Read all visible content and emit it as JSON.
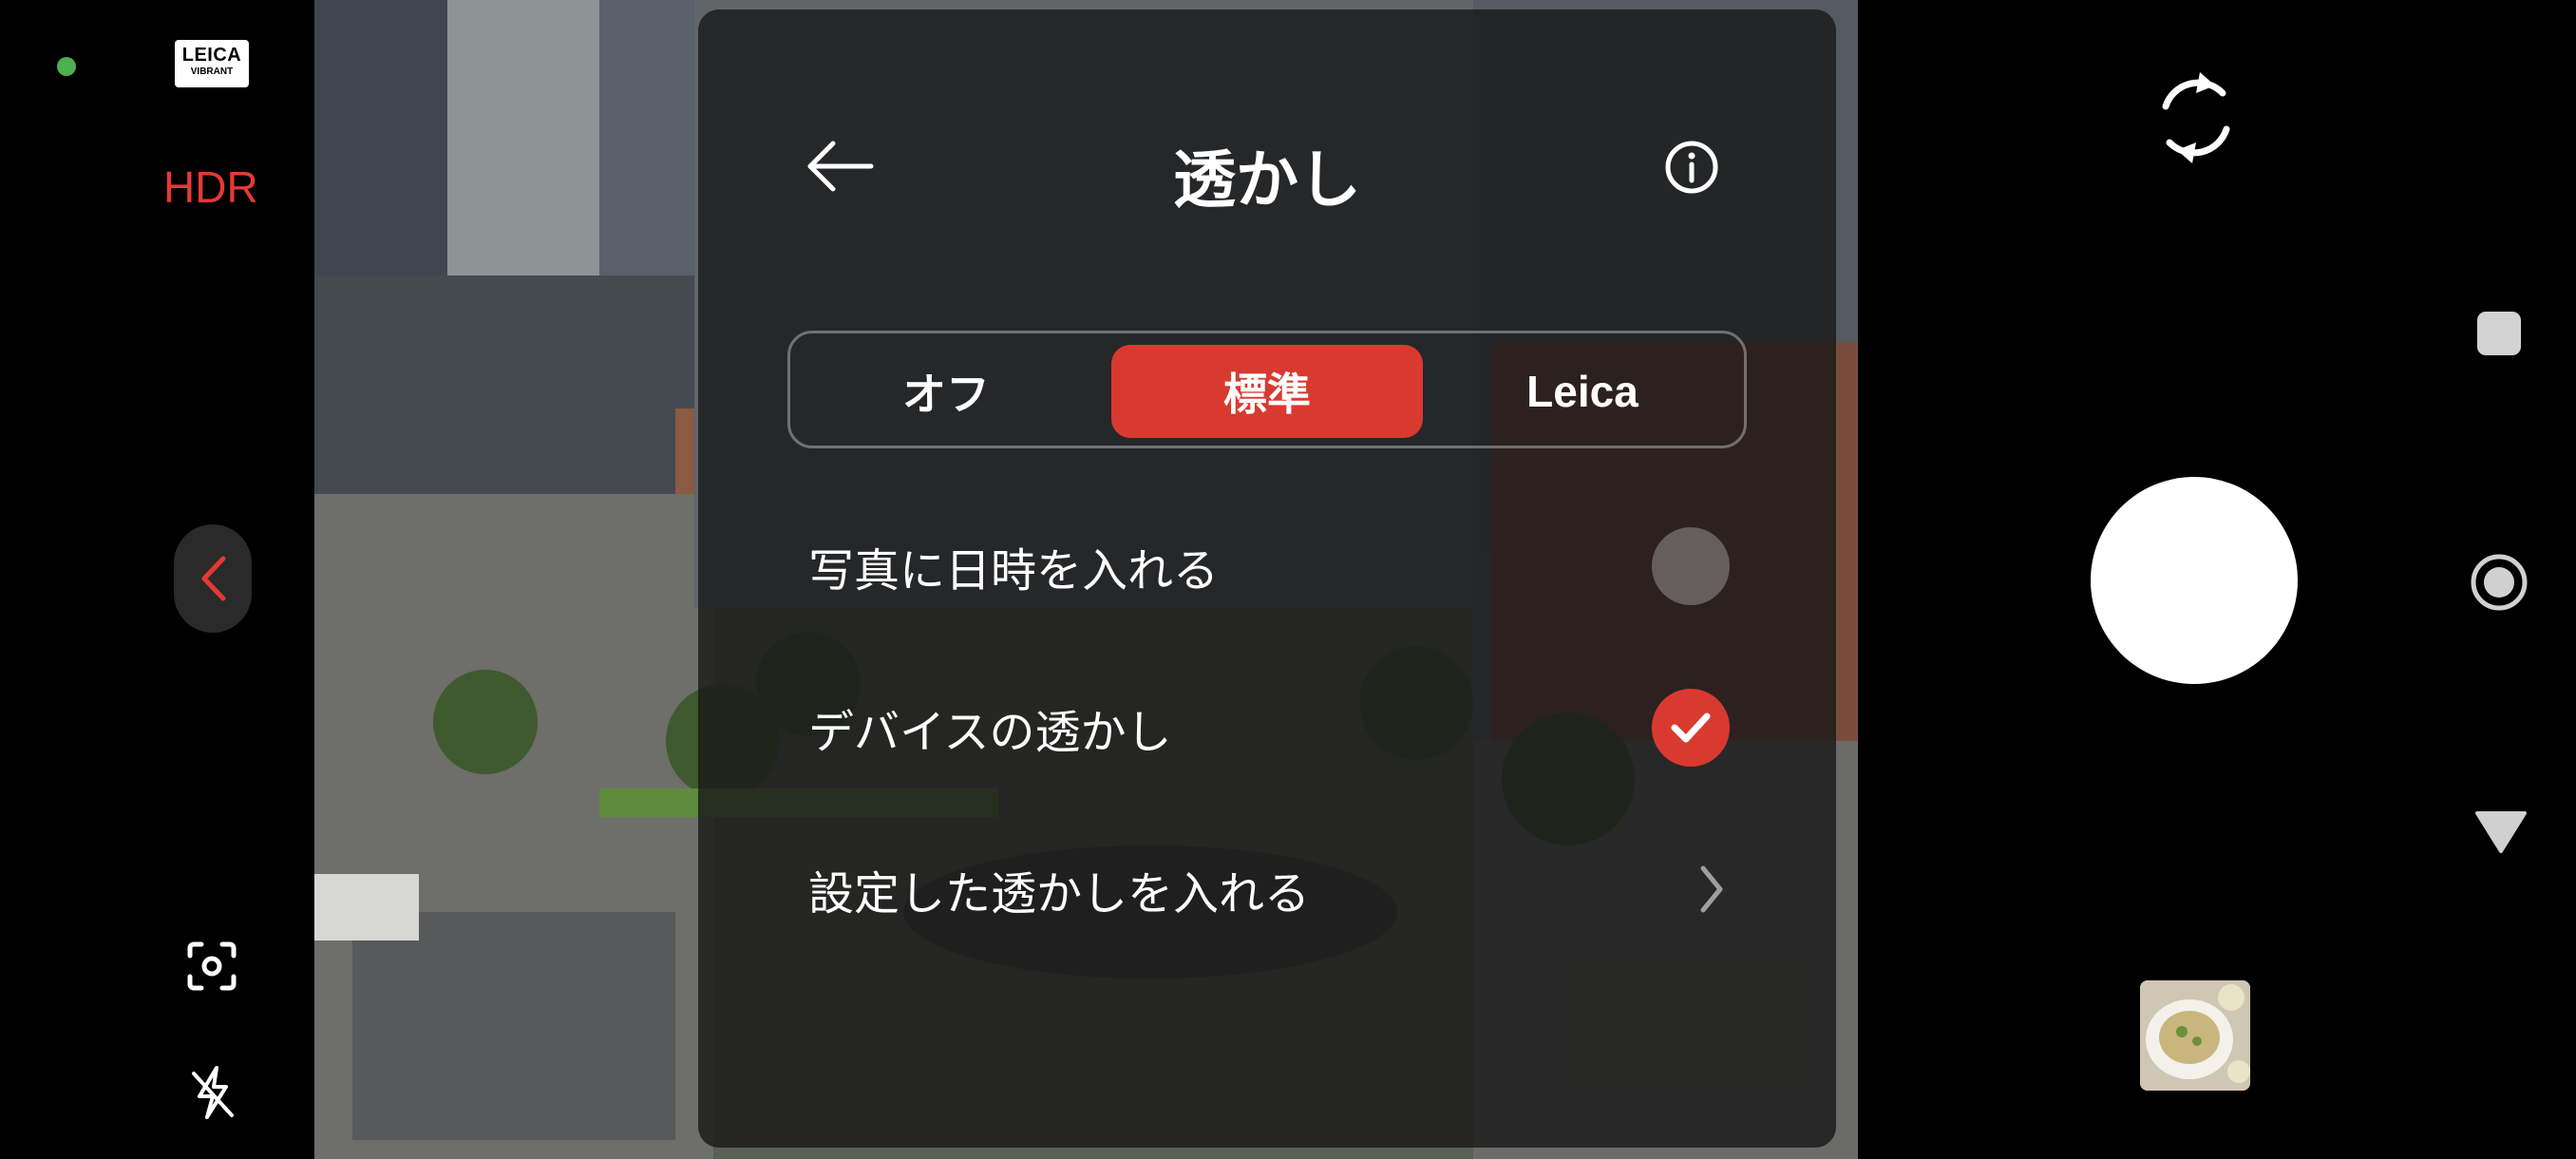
{
  "left_rail": {
    "leica_badge_line1": "LEICA",
    "leica_badge_line2": "VIBRANT",
    "hdr_label": "HDR"
  },
  "watermark_panel": {
    "title": "透かし",
    "segments": [
      {
        "label": "オフ",
        "selected": false
      },
      {
        "label": "標準",
        "selected": true
      },
      {
        "label": "Leica",
        "selected": false
      }
    ],
    "rows": [
      {
        "label": "写真に日時を入れる",
        "control": "toggle",
        "checked": false
      },
      {
        "label": "デバイスの透かし",
        "control": "toggle",
        "checked": true
      },
      {
        "label": "設定した透かしを入れる",
        "control": "chevron"
      }
    ]
  },
  "colors": {
    "accent_red": "#d93a30",
    "status_green": "#4caf50",
    "hdr_red": "#e53935"
  },
  "icons": [
    "back-arrow-icon",
    "info-icon",
    "check-icon",
    "chevron-right-icon",
    "switch-camera-icon",
    "lens-focus-icon",
    "flash-off-icon",
    "collapse-left-icon",
    "mode-ring-icon",
    "triangle-down-icon"
  ]
}
